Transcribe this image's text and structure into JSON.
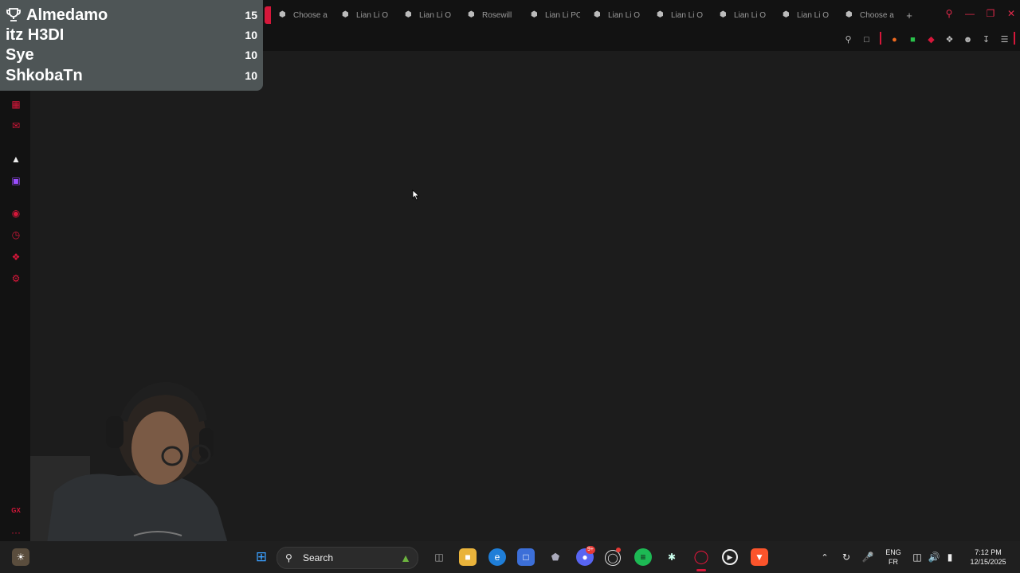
{
  "browser": {
    "tabs": [
      {
        "title": "Choose a"
      },
      {
        "title": "Lian Li O"
      },
      {
        "title": "Lian Li O"
      },
      {
        "title": "Rosewill"
      },
      {
        "title": "Lian Li PC"
      },
      {
        "title": "Lian Li O"
      },
      {
        "title": "Lian Li O"
      },
      {
        "title": "Lian Li O"
      },
      {
        "title": "Lian Li O"
      },
      {
        "title": "Choose a"
      }
    ],
    "new_tab_label": "+",
    "sidebar_badge": "GX",
    "sidebar_more": "···",
    "accent_color": "#d6173a"
  },
  "leaderboard": {
    "rows": [
      {
        "name": "Almedamo",
        "score": "15"
      },
      {
        "name": "itz H3DI",
        "score": "10"
      },
      {
        "name": "Sye",
        "score": "10"
      },
      {
        "name": "ShkobaTn",
        "score": "10"
      }
    ]
  },
  "taskbar": {
    "search_placeholder": "Search",
    "discord_badge": "9+",
    "language_top": "ENG",
    "language_bottom": "FR",
    "time": "7:12 PM",
    "date": "12/15/2025"
  }
}
